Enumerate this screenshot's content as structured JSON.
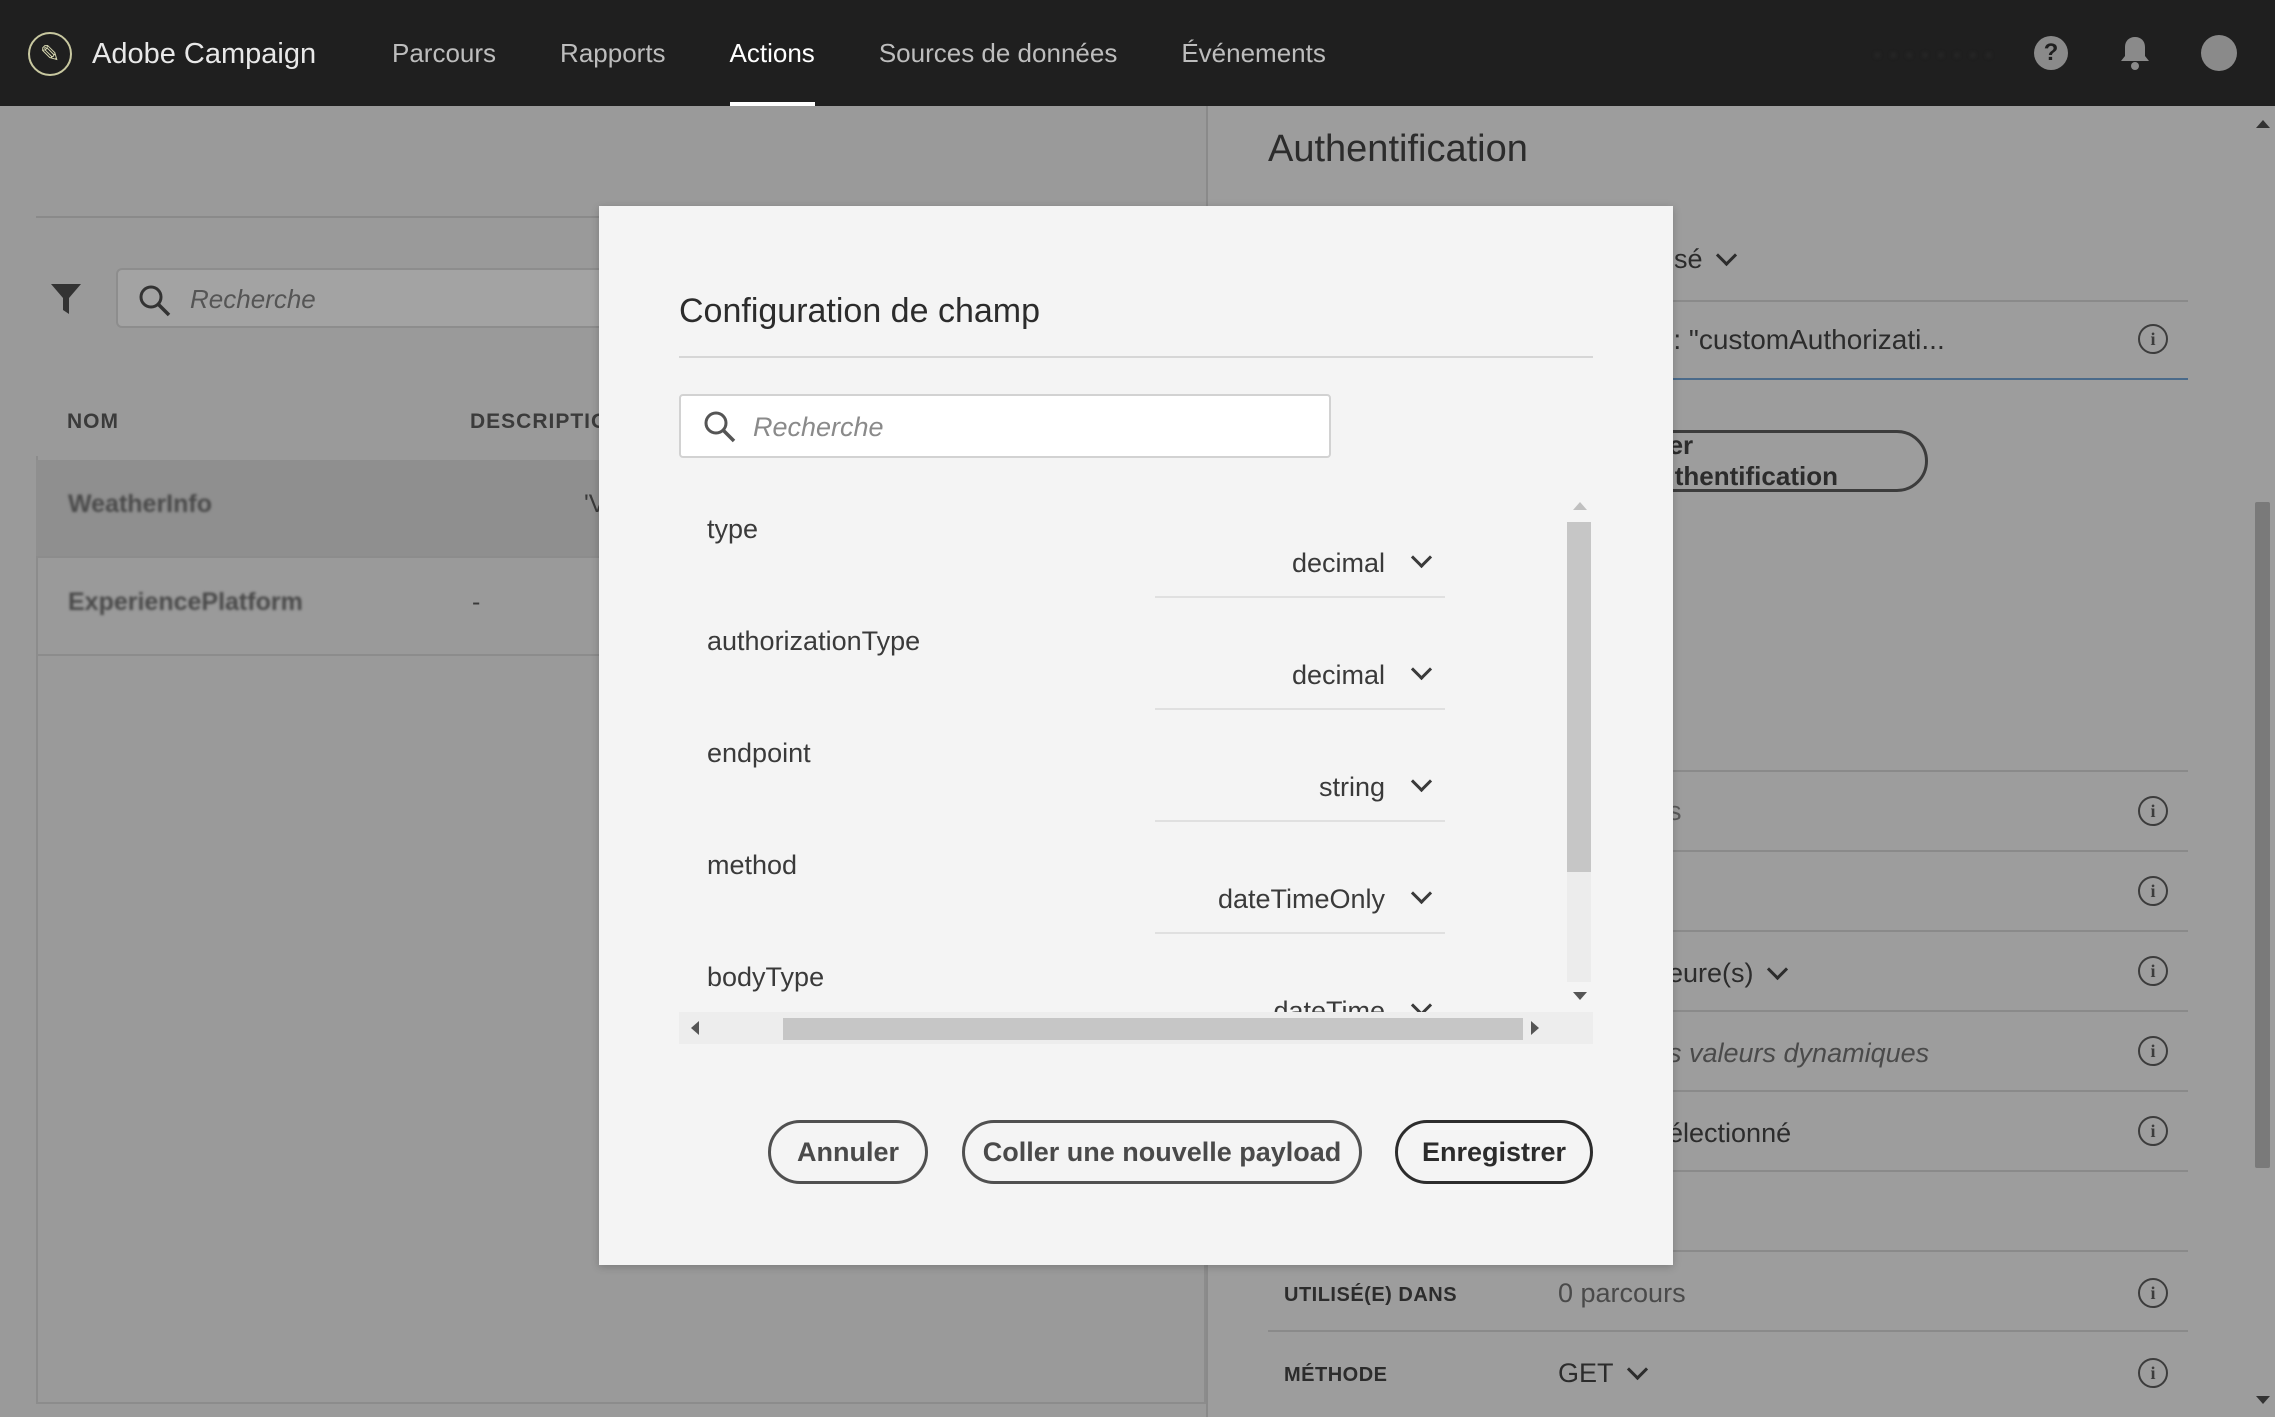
{
  "app": {
    "brand": "Adobe Campaign",
    "blurred_org": "· · · · · · · ·"
  },
  "nav": {
    "items": [
      "Parcours",
      "Rapports",
      "Actions",
      "Sources de données",
      "Événements"
    ],
    "active": "Actions"
  },
  "left": {
    "search_placeholder": "Recherche",
    "columns": {
      "name": "NOM",
      "description": "DESCRIPTIO"
    },
    "rows": [
      {
        "name": "WeatherInfo",
        "description": "'V"
      },
      {
        "name": "ExperiencePlatform",
        "description": "-"
      }
    ]
  },
  "right": {
    "title": "Authentification",
    "auth_type_partial": "isé",
    "payload_partial": "': \"customAuthorizati...",
    "test_button": "ester l'authentification",
    "row_partial_1": "s",
    "row_partial_2": "eure(s)",
    "row_partial_3": "s valeurs dynamiques",
    "row_partial_4": "électionné",
    "used_in_label": "UTILISÉ(E) DANS",
    "used_in_value": "0 parcours",
    "method_label": "MÉTHODE",
    "method_value": "GET"
  },
  "modal": {
    "title": "Configuration de champ",
    "search_placeholder": "Recherche",
    "fields": [
      {
        "name": "type",
        "type": "decimal"
      },
      {
        "name": "authorizationType",
        "type": "decimal"
      },
      {
        "name": "endpoint",
        "type": "string"
      },
      {
        "name": "method",
        "type": "dateTimeOnly"
      },
      {
        "name": "bodyType",
        "type": "dateTime"
      }
    ],
    "buttons": {
      "cancel": "Annuler",
      "paste": "Coller une nouvelle payload",
      "save": "Enregistrer"
    }
  }
}
